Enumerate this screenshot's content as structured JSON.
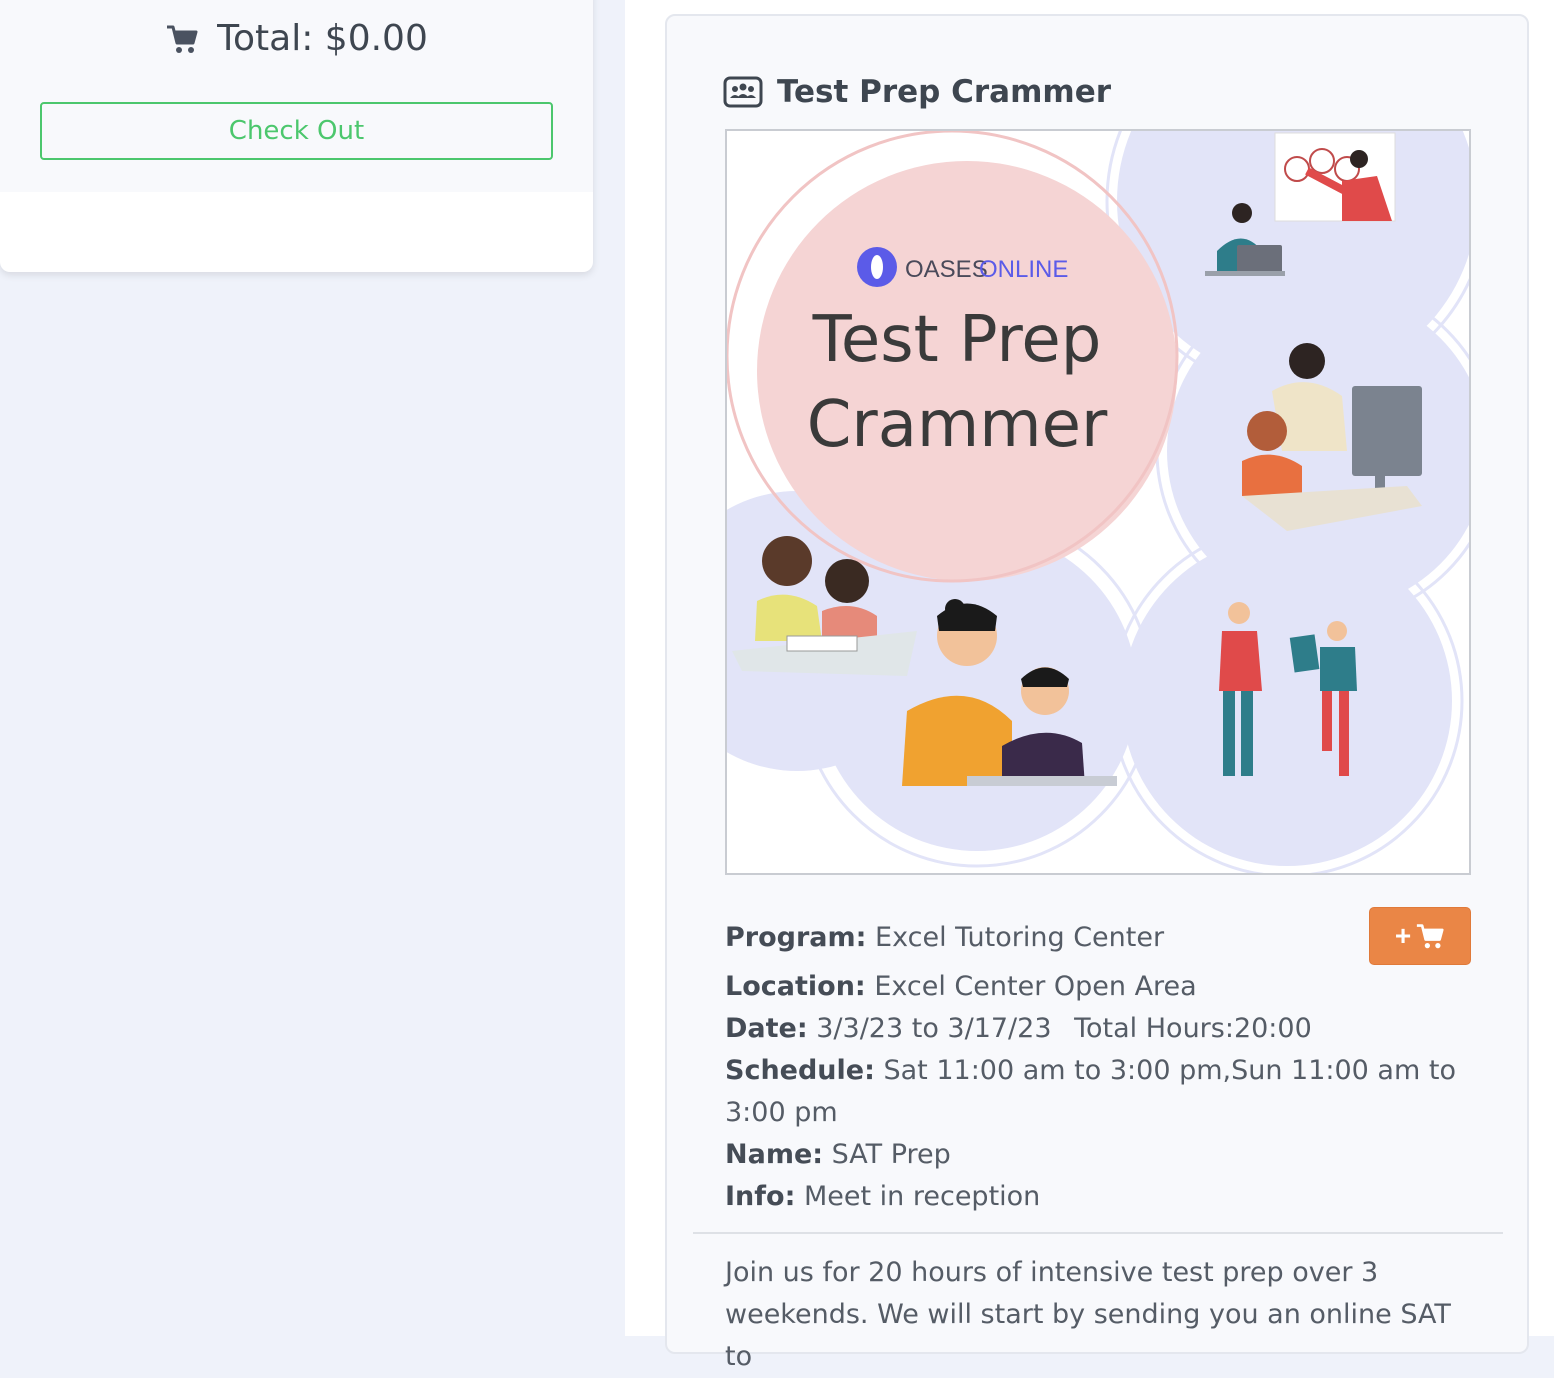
{
  "cart": {
    "total_label": "Total: $0.00",
    "checkout_label": "Check Out"
  },
  "program_card": {
    "title": "Test Prep Crammer",
    "poster": {
      "brand_a": "OASES",
      "brand_b": "ONLINE",
      "headline_line1": "Test Prep",
      "headline_line2": "Crammer"
    },
    "add_to_cart_plus": "+",
    "details": {
      "program_label": "Program:",
      "program_value": "Excel Tutoring Center",
      "location_label": "Location:",
      "location_value": "Excel Center Open Area",
      "date_label": "Date:",
      "date_value": "3/3/23 to 3/17/23",
      "hours_value": "Total Hours:20:00",
      "schedule_label": "Schedule:",
      "schedule_value": "Sat 11:00 am to 3:00 pm,Sun 11:00 am to 3:00 pm",
      "name_label": "Name:",
      "name_value": "SAT Prep",
      "info_label": "Info:",
      "info_value": "Meet in reception"
    },
    "description": "Join us for 20 hours of intensive test prep over 3 weekends. We will start by sending you an online SAT to"
  },
  "colors": {
    "checkout_green": "#4cc76d",
    "add_cart_orange": "#ea8646",
    "poster_pink": "#f5d4d4",
    "poster_lavender": "#e2e4f8",
    "brand_purple": "#5b5be8"
  },
  "icons": {
    "cart": "shopping-cart-icon",
    "title": "users-card-icon",
    "add_cart": "cart-plus-icon"
  }
}
